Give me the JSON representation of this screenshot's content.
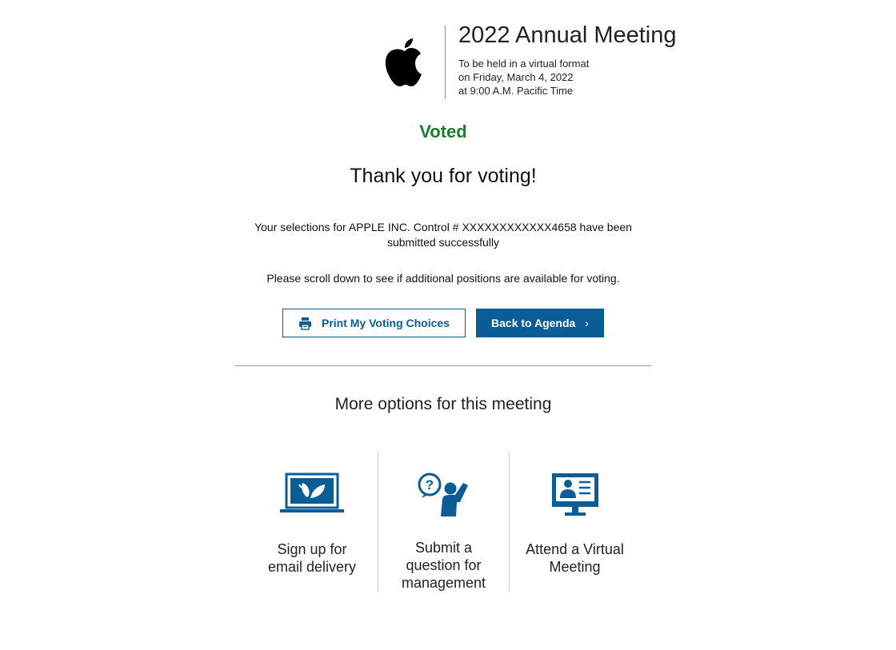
{
  "header": {
    "logo": "apple-logo",
    "title": "2022 Annual Meeting",
    "lines": [
      "To be held in a virtual format",
      "on Friday, March 4, 2022",
      "at 9:00 A.M. Pacific Time"
    ]
  },
  "status": {
    "label": "Voted",
    "color": "#1b7e2a"
  },
  "thanks": "Thank you for voting!",
  "selections_message": "Your selections for APPLE INC. Control # XXXXXXXXXXXX4658 have been submitted successfully",
  "scroll_note": "Please scroll down to see if additional positions are available for voting.",
  "buttons": {
    "print": {
      "label": "Print My Voting Choices",
      "icon": "printer-icon"
    },
    "back": {
      "label": "Back to Agenda",
      "icon": "chevron-right-icon"
    }
  },
  "more_options": {
    "title": "More options for this meeting",
    "items": [
      {
        "label": "Sign up for email delivery",
        "icon": "laptop-leaf-icon"
      },
      {
        "label": "Submit a question for management",
        "icon": "person-question-icon"
      },
      {
        "label": "Attend a Virtual Meeting",
        "icon": "monitor-presenter-icon"
      }
    ]
  },
  "colors": {
    "accent": "#0a5d96",
    "success": "#1b7e2a"
  }
}
